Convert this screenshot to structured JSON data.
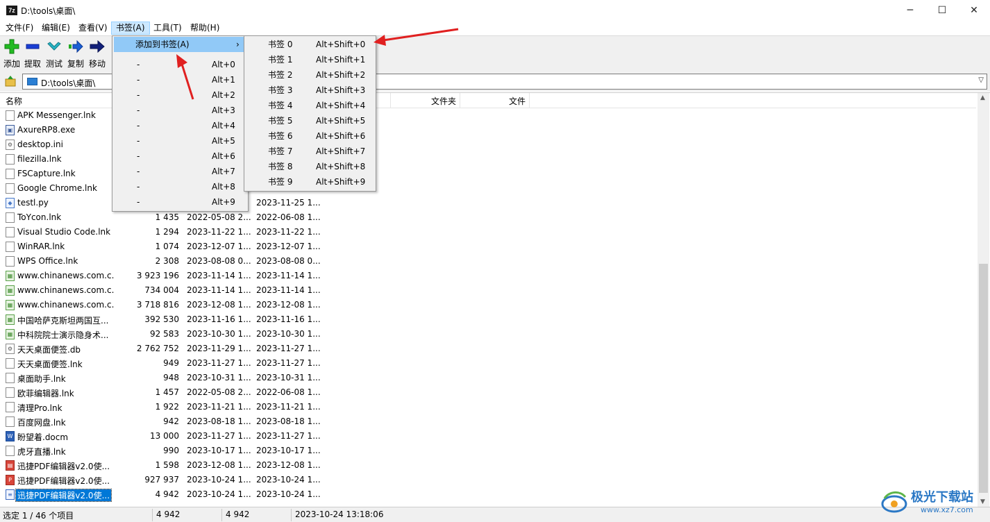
{
  "window": {
    "title": "D:\\tools\\桌面\\",
    "app_icon_text": "7z",
    "minimize": "─",
    "maximize": "☐",
    "close": "✕"
  },
  "menubar": {
    "items": [
      "文件(F)",
      "编辑(E)",
      "查看(V)",
      "书签(A)",
      "工具(T)",
      "帮助(H)"
    ]
  },
  "toolbar": {
    "buttons": [
      "添加",
      "提取",
      "测试",
      "复制",
      "移动"
    ]
  },
  "address": {
    "path": "D:\\tools\\桌面\\"
  },
  "columns": {
    "name": "名称",
    "folders": "文件夹",
    "files": "文件"
  },
  "files": [
    {
      "name": "APK Messenger.lnk",
      "size": "",
      "modified": "",
      "created": "",
      "icon": "file"
    },
    {
      "name": "AxureRP8.exe",
      "size": "",
      "modified": "",
      "created": "",
      "icon": "exe"
    },
    {
      "name": "desktop.ini",
      "size": "",
      "modified": "",
      "created": "",
      "icon": "ini"
    },
    {
      "name": "filezilla.lnk",
      "size": "",
      "modified": "",
      "created": "",
      "icon": "file"
    },
    {
      "name": "FSCapture.lnk",
      "size": "",
      "modified": "",
      "created": "",
      "icon": "file"
    },
    {
      "name": "Google Chrome.lnk",
      "size": "",
      "modified": "",
      "created": "",
      "icon": "file"
    },
    {
      "name": "testl.py",
      "size": "",
      "modified": "",
      "created": "2023-11-25 1...",
      "icon": "py"
    },
    {
      "name": "ToYcon.lnk",
      "size": "1 435",
      "modified": "2022-05-08 2...",
      "created": "2022-06-08 1...",
      "icon": "file"
    },
    {
      "name": "Visual Studio Code.lnk",
      "size": "1 294",
      "modified": "2023-11-22 1...",
      "created": "2023-11-22 1...",
      "icon": "file"
    },
    {
      "name": "WinRAR.lnk",
      "size": "1 074",
      "modified": "2023-12-07 1...",
      "created": "2023-12-07 1...",
      "icon": "file"
    },
    {
      "name": "WPS Office.lnk",
      "size": "2 308",
      "modified": "2023-08-08 0...",
      "created": "2023-08-08 0...",
      "icon": "file"
    },
    {
      "name": "www.chinanews.com.c...",
      "size": "3 923 196",
      "modified": "2023-11-14 1...",
      "created": "2023-11-14 1...",
      "icon": "img"
    },
    {
      "name": "www.chinanews.com.c...",
      "size": "734 004",
      "modified": "2023-11-14 1...",
      "created": "2023-11-14 1...",
      "icon": "img"
    },
    {
      "name": "www.chinanews.com.c...",
      "size": "3 718 816",
      "modified": "2023-12-08 1...",
      "created": "2023-12-08 1...",
      "icon": "img"
    },
    {
      "name": "中国哈萨克斯坦两国互...",
      "size": "392 530",
      "modified": "2023-11-16 1...",
      "created": "2023-11-16 1...",
      "icon": "img"
    },
    {
      "name": "中科院院士演示隐身术...",
      "size": "92 583",
      "modified": "2023-10-30 1...",
      "created": "2023-10-30 1...",
      "icon": "img"
    },
    {
      "name": "天天桌面便签.db",
      "size": "2 762 752",
      "modified": "2023-11-29 1...",
      "created": "2023-11-27 1...",
      "icon": "db"
    },
    {
      "name": "天天桌面便签.lnk",
      "size": "949",
      "modified": "2023-11-27 1...",
      "created": "2023-11-27 1...",
      "icon": "file"
    },
    {
      "name": "桌面助手.lnk",
      "size": "948",
      "modified": "2023-10-31 1...",
      "created": "2023-10-31 1...",
      "icon": "file"
    },
    {
      "name": "欧菲编辑器.lnk",
      "size": "1 457",
      "modified": "2022-05-08 2...",
      "created": "2022-06-08 1...",
      "icon": "file"
    },
    {
      "name": "清理Pro.lnk",
      "size": "1 922",
      "modified": "2023-11-21 1...",
      "created": "2023-11-21 1...",
      "icon": "file"
    },
    {
      "name": "百度网盘.lnk",
      "size": "942",
      "modified": "2023-08-18 1...",
      "created": "2023-08-18 1...",
      "icon": "file"
    },
    {
      "name": "盼望着.docm",
      "size": "13 000",
      "modified": "2023-11-27 1...",
      "created": "2023-11-27 1...",
      "icon": "doc"
    },
    {
      "name": "虎牙直播.lnk",
      "size": "990",
      "modified": "2023-10-17 1...",
      "created": "2023-10-17 1...",
      "icon": "file"
    },
    {
      "name": "迅捷PDF编辑器v2.0使...",
      "size": "1 598",
      "modified": "2023-12-08 1...",
      "created": "2023-12-08 1...",
      "icon": "pdfapp"
    },
    {
      "name": "迅捷PDF编辑器v2.0使...",
      "size": "927 937",
      "modified": "2023-10-24 1...",
      "created": "2023-10-24 1...",
      "icon": "pdf"
    },
    {
      "name": "迅捷PDF编辑器v2.0使...",
      "size": "4 942",
      "modified": "2023-10-24 1...",
      "created": "2023-10-24 1...",
      "icon": "txt",
      "selected": true
    }
  ],
  "bookmarks_menu": {
    "add_label": "添加到书签(A)",
    "submenu_arrow": "›",
    "items": [
      {
        "label": "-",
        "shortcut": "Alt+0"
      },
      {
        "label": "-",
        "shortcut": "Alt+1"
      },
      {
        "label": "-",
        "shortcut": "Alt+2"
      },
      {
        "label": "-",
        "shortcut": "Alt+3"
      },
      {
        "label": "-",
        "shortcut": "Alt+4"
      },
      {
        "label": "-",
        "shortcut": "Alt+5"
      },
      {
        "label": "-",
        "shortcut": "Alt+6"
      },
      {
        "label": "-",
        "shortcut": "Alt+7"
      },
      {
        "label": "-",
        "shortcut": "Alt+8"
      },
      {
        "label": "-",
        "shortcut": "Alt+9"
      }
    ]
  },
  "add_bookmark_submenu": {
    "items": [
      {
        "label": "书签 0",
        "shortcut": "Alt+Shift+0"
      },
      {
        "label": "书签 1",
        "shortcut": "Alt+Shift+1"
      },
      {
        "label": "书签 2",
        "shortcut": "Alt+Shift+2"
      },
      {
        "label": "书签 3",
        "shortcut": "Alt+Shift+3"
      },
      {
        "label": "书签 4",
        "shortcut": "Alt+Shift+4"
      },
      {
        "label": "书签 5",
        "shortcut": "Alt+Shift+5"
      },
      {
        "label": "书签 6",
        "shortcut": "Alt+Shift+6"
      },
      {
        "label": "书签 7",
        "shortcut": "Alt+Shift+7"
      },
      {
        "label": "书签 8",
        "shortcut": "Alt+Shift+8"
      },
      {
        "label": "书签 9",
        "shortcut": "Alt+Shift+9"
      }
    ]
  },
  "status": {
    "selection": "选定 1 / 46 个项目",
    "size": "4 942",
    "packed": "4 942",
    "modified": "2023-10-24 13:18:06"
  },
  "watermark": {
    "title": "极光下载站",
    "url": "www.xz7.com"
  },
  "colors": {
    "menu_highlight": "#91c9f7",
    "selection": "#0078d7",
    "annotation_arrow": "#e02020"
  }
}
